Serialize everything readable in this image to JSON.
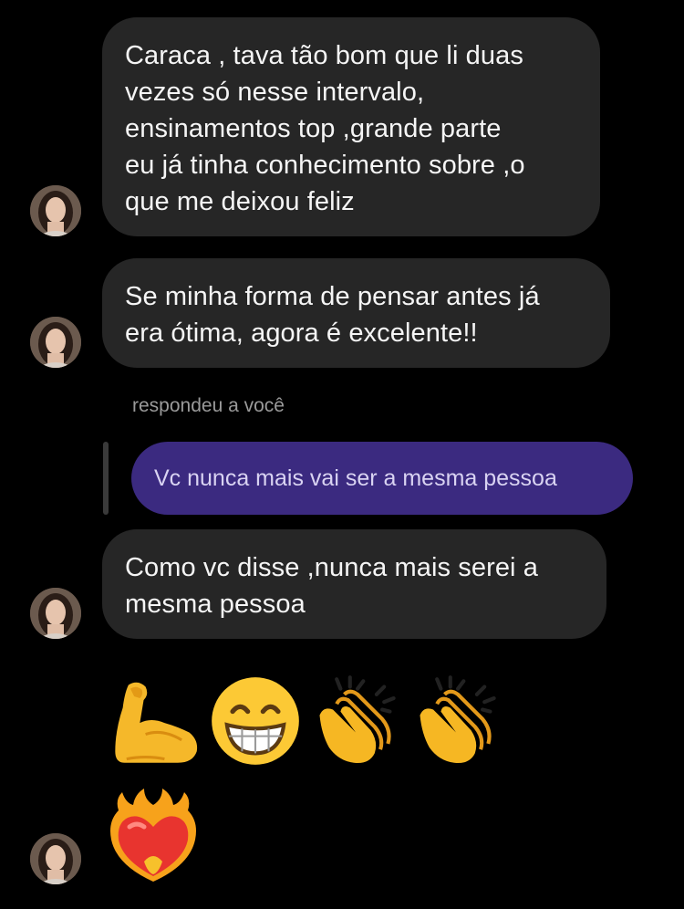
{
  "conversation": {
    "messages": [
      {
        "from": "them",
        "lines": [
          "Caraca , tava tão bom que li duas",
          "vezes só nesse intervalo,",
          "ensinamentos top ,grande parte",
          "eu já tinha conhecimento sobre ,o",
          "que me deixou feliz"
        ]
      },
      {
        "from": "them",
        "lines": [
          "Se minha forma de pensar antes já",
          "era ótima, agora é excelente!!"
        ]
      },
      {
        "from": "them",
        "reply_label": "respondeu a você",
        "quoted_text": "Vc nunca mais vai ser a mesma pessoa",
        "lines": [
          "Como vc disse ,nunca mais serei a",
          "mesma pessoa"
        ]
      }
    ],
    "emoji_message": {
      "icons": [
        "flexed-biceps-icon",
        "grinning-face-icon",
        "clapping-hands-icon",
        "clapping-hands-icon"
      ]
    },
    "heart_message": {
      "icon": "heart-on-fire-icon"
    }
  },
  "colors": {
    "background": "#000000",
    "incoming_bubble": "#262626",
    "quoted_bubble": "#3b2a80",
    "secondary_text": "#9a9a9a"
  }
}
